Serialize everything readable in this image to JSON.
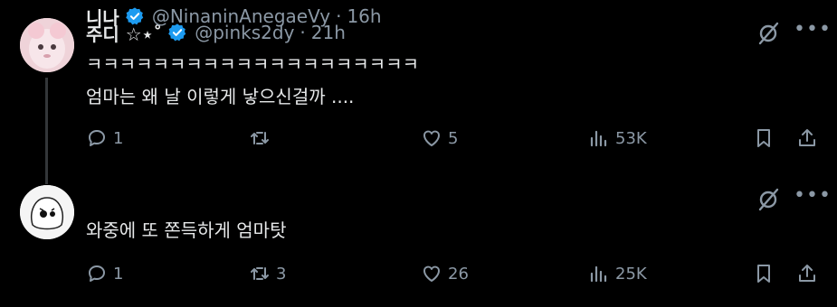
{
  "tweets": [
    {
      "name": "주디 ☆⋆˚",
      "handle": "@pinks2dy",
      "time": "21h",
      "lines": [
        "ㅋㅋㅋㅋㅋㅋㅋㅋㅋㅋㅋㅋㅋㅋㅋㅋㅋㅋㅋㅋ",
        "엄마는 왜 날 이렇게 낳으신걸까 ...."
      ],
      "replies": "1",
      "retweets": "",
      "likes": "5",
      "views": "53K"
    },
    {
      "name": "니나",
      "handle": "@NinaninAnegaeVy",
      "time": "16h",
      "lines": [
        "와중에 또 쫀득하게 엄마탓"
      ],
      "replies": "1",
      "retweets": "3",
      "likes": "26",
      "views": "25K"
    }
  ],
  "icons": {
    "verified": "verified-badge-icon",
    "grok": "grok-icon",
    "more": "more-icon",
    "reply": "reply-icon",
    "retweet": "retweet-icon",
    "like": "heart-icon",
    "views": "views-icon",
    "bookmark": "bookmark-icon",
    "share": "share-icon"
  },
  "colors": {
    "background": "#000000",
    "text": "#e7e9ea",
    "secondary": "#8b98a5",
    "verified": "#1d9bf0"
  }
}
